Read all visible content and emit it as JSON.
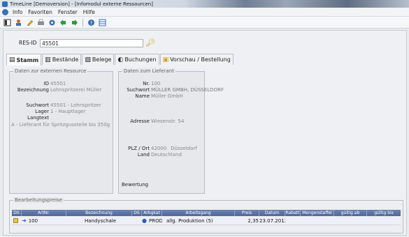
{
  "window": {
    "title": "TimeLine [Demoversion] - [Infomodul externe Ressourcen]"
  },
  "menu": {
    "items": [
      "Info",
      "Favoriten",
      "Fenster",
      "Hilfe"
    ]
  },
  "toolbar": {
    "icons": [
      "view-icon",
      "user-icon",
      "edit-icon",
      "print-icon",
      "target-icon",
      "back-icon",
      "forward-icon",
      "help-icon",
      "grid-icon"
    ]
  },
  "resid": {
    "label": "RES-ID",
    "value": "45501"
  },
  "tabs": [
    {
      "label": "Stamm",
      "icon": "document-icon"
    },
    {
      "label": "Bestände",
      "icon": "stock-icon"
    },
    {
      "label": "Belege",
      "icon": "receipts-icon"
    },
    {
      "label": "Buchungen",
      "icon": "bookings-icon"
    },
    {
      "label": "Vorschau / Bestellung",
      "icon": "folder-icon"
    }
  ],
  "left_panel": {
    "title": "Daten zur externen Resource",
    "id_label": "ID",
    "id_value": "45501",
    "bez_label": "Bezeichnung",
    "bez_value": "Lohnspritzerei Müller",
    "such_label": "Suchwort",
    "such_value": "45501 - Lohnspritzer",
    "lager_label": "Lager",
    "lager_value": "1 - Hauptlager",
    "langtext_label": "Langtext",
    "langtext_value": "A - Lieferant für Spritzgussteile bis 350g"
  },
  "right_panel": {
    "title": "Daten zum Lieferant",
    "nr_label": "Nr.",
    "nr_value": "100",
    "such_label": "Suchwort",
    "such_value": "MÜLLER GMBH, DÜSSELDORF",
    "name_label": "Name",
    "name_value": "Müller GmbH",
    "adresse_label": "Adresse",
    "adresse_value": "Wiesenstr. 54",
    "plz_label": "PLZ / Ort",
    "plz_value": "42000",
    "ort_value": "Düsseldorf",
    "land_label": "Land",
    "land_value": "Deutschland",
    "bewertung_label": "Bewertung"
  },
  "grid": {
    "title": "Bearbeitungspreise",
    "columns": [
      "DS",
      "ArtNr.",
      "Bezeichnung",
      "DS",
      "Arbgkat",
      "Arbeitsgang",
      "Preis",
      "Datum",
      "Rabatt",
      "Mengenstaffel",
      "gültig ab",
      "gültig bis"
    ],
    "rows": [
      {
        "artnr": "100",
        "bezeichnung": "Handyschale",
        "arbgkat": "PROD",
        "arbeitsgang": "allg. Produktion (5)",
        "preis": "2,35",
        "datum": "23.07.2012"
      }
    ]
  }
}
